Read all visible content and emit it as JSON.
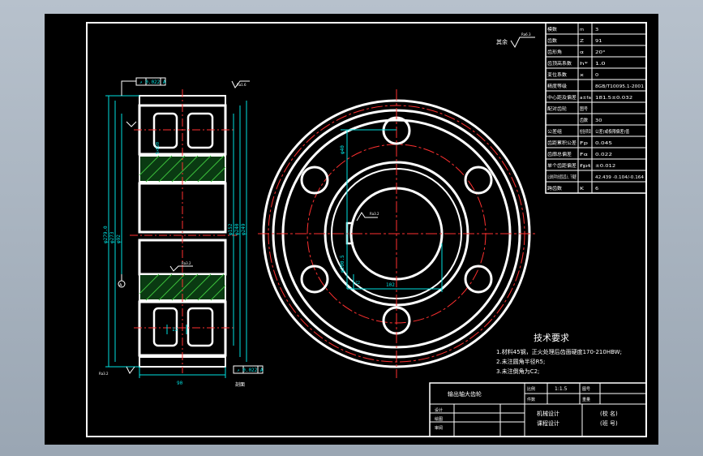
{
  "tech_requirements": {
    "title": "技术要求",
    "items": [
      "1.材料45钢，正火处理后齿面硬度170-210HBW;",
      "2.未注圆角半径R5;",
      "3.未注倒角为C2;"
    ]
  },
  "param_table": {
    "rows": [
      {
        "name": "模数",
        "symbol": "m",
        "value": "3"
      },
      {
        "name": "齿数",
        "symbol": "Z",
        "value": "91"
      },
      {
        "name": "齿形角",
        "symbol": "α",
        "value": "20°"
      },
      {
        "name": "齿顶高系数",
        "symbol": "h*",
        "value": "1.0"
      },
      {
        "name": "变位系数",
        "symbol": "x",
        "value": "0"
      },
      {
        "name": "精度等级",
        "symbol": "",
        "value": "8GB/T10095.1-2001"
      },
      {
        "name": "中心距及偏差",
        "symbol": "a±fa",
        "value": "181.5±0.032"
      },
      {
        "name": "配对齿轮",
        "symbol": "图号",
        "value": ""
      },
      {
        "name": "",
        "symbol": "齿数",
        "value": "30"
      },
      {
        "name": "公差组",
        "symbol": "检验项目",
        "value": "公差(或极限偏差)值"
      },
      {
        "name": "齿距累积公差",
        "symbol": "Fp",
        "value": "0.045"
      },
      {
        "name": "齿廓总偏差",
        "symbol": "Fα",
        "value": "0.022"
      },
      {
        "name": "单个齿距偏差",
        "symbol": "fpt",
        "value": "±0.012"
      },
      {
        "name": "公法线平均长度及其上、下偏差",
        "symbol": "",
        "value": "42.439 -0.104/-0.164"
      },
      {
        "name": "跨齿数",
        "symbol": "K",
        "value": "6"
      }
    ]
  },
  "title_block": {
    "part_name": "输出轴大齿轮",
    "material": "45",
    "ratio_label": "比例",
    "ratio_value": "1:1.5",
    "drawing_no_label": "图号",
    "piece_label": "件数",
    "weight_label": "重量",
    "sheet_label": "共张 第张",
    "designer_label": "设计",
    "drafter_label": "绘图",
    "checker_label": "审阅",
    "course1": "机械设计",
    "course2": "课程设计",
    "school": "(校 名)",
    "class_no": "(班 号)"
  },
  "annotations": {
    "roughness_rest": "其余",
    "roughness_value": "Ra6.3",
    "roughness_small": "Ra3.2",
    "roughness_fine": "Ra1.6",
    "runout_top": "↗ 0.022 A",
    "runout_bottom": "↗ 0.022 A",
    "datum": "A",
    "width_dim": "90",
    "section_label": "剖面",
    "dim_da": "φ279.0",
    "dim_d": "φ273",
    "dim_bore": "φ92",
    "dim_hub1": "φ152",
    "dim_hub2": "φ240",
    "dim_hub3": "φ249",
    "dim_web": "12",
    "dim_fillet": "5×R20",
    "dim_keyway": "102",
    "dim_key_depth": "60",
    "dim_hole": "φ40",
    "dim_hole_circle": "φ200.5",
    "dim_key_width": "22"
  }
}
